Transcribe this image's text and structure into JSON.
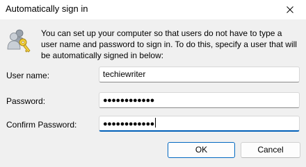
{
  "window": {
    "title": "Automatically sign in",
    "close_icon": "close-icon"
  },
  "icon": {
    "name": "users-keys-icon"
  },
  "description": "You can set up your computer so that users do not have to type a user name and password to sign in. To do this, specify a user that will be automatically signed in below:",
  "fields": {
    "username": {
      "label": "User name:",
      "value": "techiewriter"
    },
    "password": {
      "label": "Password:",
      "value": "●●●●●●●●●●●●"
    },
    "confirm_password": {
      "label": "Confirm Password:",
      "value": "●●●●●●●●●●●●"
    }
  },
  "buttons": {
    "ok": "OK",
    "cancel": "Cancel"
  },
  "colors": {
    "accent": "#005fb8",
    "background": "#f0f0f0"
  }
}
